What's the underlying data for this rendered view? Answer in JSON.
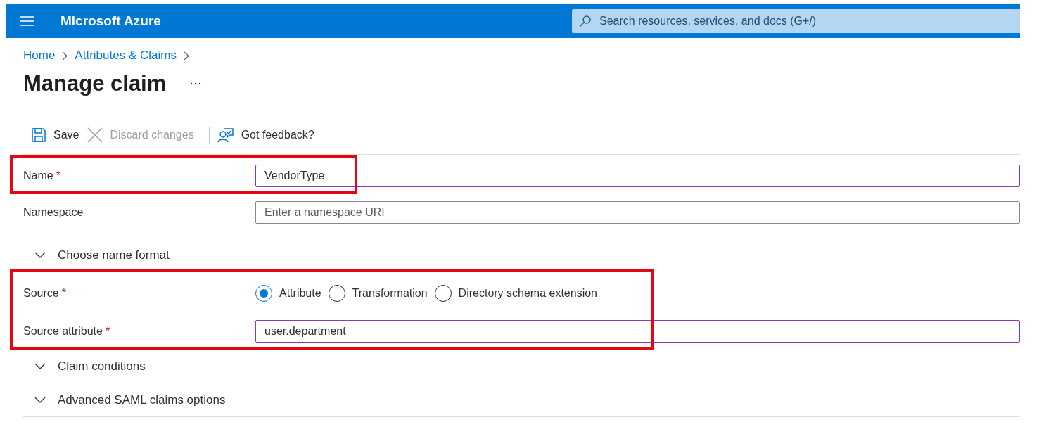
{
  "header": {
    "title": "Microsoft Azure",
    "search_placeholder": "Search resources, services, and docs (G+/)"
  },
  "breadcrumb": [
    "Home",
    "Attributes & Claims"
  ],
  "title": "Manage claim",
  "toolbar": [
    {
      "kind": "save",
      "label": "Save",
      "disabled": false
    },
    {
      "kind": "discard",
      "label": "Discard changes",
      "disabled": true
    },
    {
      "kind": "feedback",
      "label": "Got feedback?",
      "disabled": false
    }
  ],
  "groups": [
    {
      "highlighted": true,
      "rows": [
        {
          "kind": "text",
          "label": "Name",
          "required_mark": "*",
          "value": "VendorType",
          "focused": true
        }
      ]
    },
    {
      "highlighted": false,
      "rows": [
        {
          "kind": "text",
          "label": "Namespace",
          "placeholder": "Enter a namespace URI",
          "focused": false
        }
      ]
    },
    {
      "highlighted": false,
      "rows": [
        {
          "kind": "section",
          "label": "Choose name format",
          "expanded": false
        }
      ]
    },
    {
      "highlighted": true,
      "rows": [
        {
          "kind": "radio",
          "label": "Source",
          "required_mark": "*",
          "options": [
            {
              "label": "Attribute",
              "selected": true
            },
            {
              "label": "Transformation",
              "selected": false
            },
            {
              "label": "Directory schema extension",
              "selected": false
            }
          ]
        },
        {
          "kind": "text",
          "label": "Source attribute",
          "required_mark": "*",
          "value": "user.department",
          "focused": true
        }
      ]
    },
    {
      "highlighted": false,
      "rows": [
        {
          "kind": "section",
          "label": "Claim conditions",
          "expanded": false
        }
      ]
    },
    {
      "highlighted": false,
      "rows": [
        {
          "kind": "section",
          "label": "Advanced SAML claims options",
          "expanded": false
        }
      ]
    }
  ]
}
